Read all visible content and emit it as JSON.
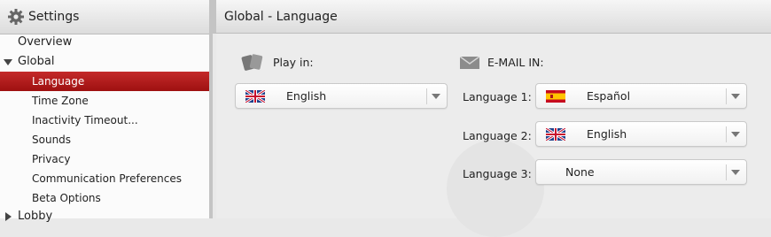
{
  "sidebar": {
    "title": "Settings",
    "items": [
      {
        "label": "Overview"
      },
      {
        "label": "Global"
      },
      {
        "label": "Language"
      },
      {
        "label": "Time Zone"
      },
      {
        "label": "Inactivity Timeout..."
      },
      {
        "label": "Sounds"
      },
      {
        "label": "Privacy"
      },
      {
        "label": "Communication Preferences"
      },
      {
        "label": "Beta Options"
      },
      {
        "label": "Lobby"
      }
    ]
  },
  "main": {
    "title": "Global - Language",
    "play_in": {
      "label": "Play in:",
      "value": "English",
      "flag": "uk-flag"
    },
    "email_in": {
      "label": "E-MAIL IN:",
      "fields": [
        {
          "label": "Language 1:",
          "value": "Español",
          "flag": "spain-flag"
        },
        {
          "label": "Language 2:",
          "value": "English",
          "flag": "uk-flag"
        },
        {
          "label": "Language 3:",
          "value": "None",
          "flag": ""
        }
      ]
    }
  },
  "colors": {
    "active_item": "#b41c1c"
  }
}
